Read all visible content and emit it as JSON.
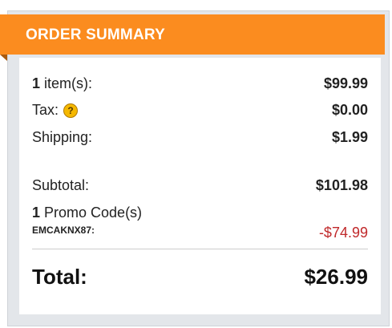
{
  "summary": {
    "title": "ORDER SUMMARY",
    "items": {
      "count": "1",
      "label": " item(s):",
      "value": "$99.99"
    },
    "tax": {
      "label": "Tax:",
      "help_glyph": "?",
      "value": "$0.00"
    },
    "shipping": {
      "label": "Shipping:",
      "value": "$1.99"
    },
    "subtotal": {
      "label": "Subtotal:",
      "value": "$101.98"
    },
    "promo": {
      "count": "1",
      "label": " Promo Code(s)",
      "code": "EMCAKNX87:",
      "value": "-$74.99"
    },
    "total": {
      "label": "Total:",
      "value": "$26.99"
    }
  },
  "colors": {
    "banner": "#fb8c1f",
    "discount": "#c0282a",
    "panel_bg": "#e3e6ea",
    "help_icon": "#f5b800"
  },
  "icons": {
    "tax_help": "question-circle-icon"
  }
}
